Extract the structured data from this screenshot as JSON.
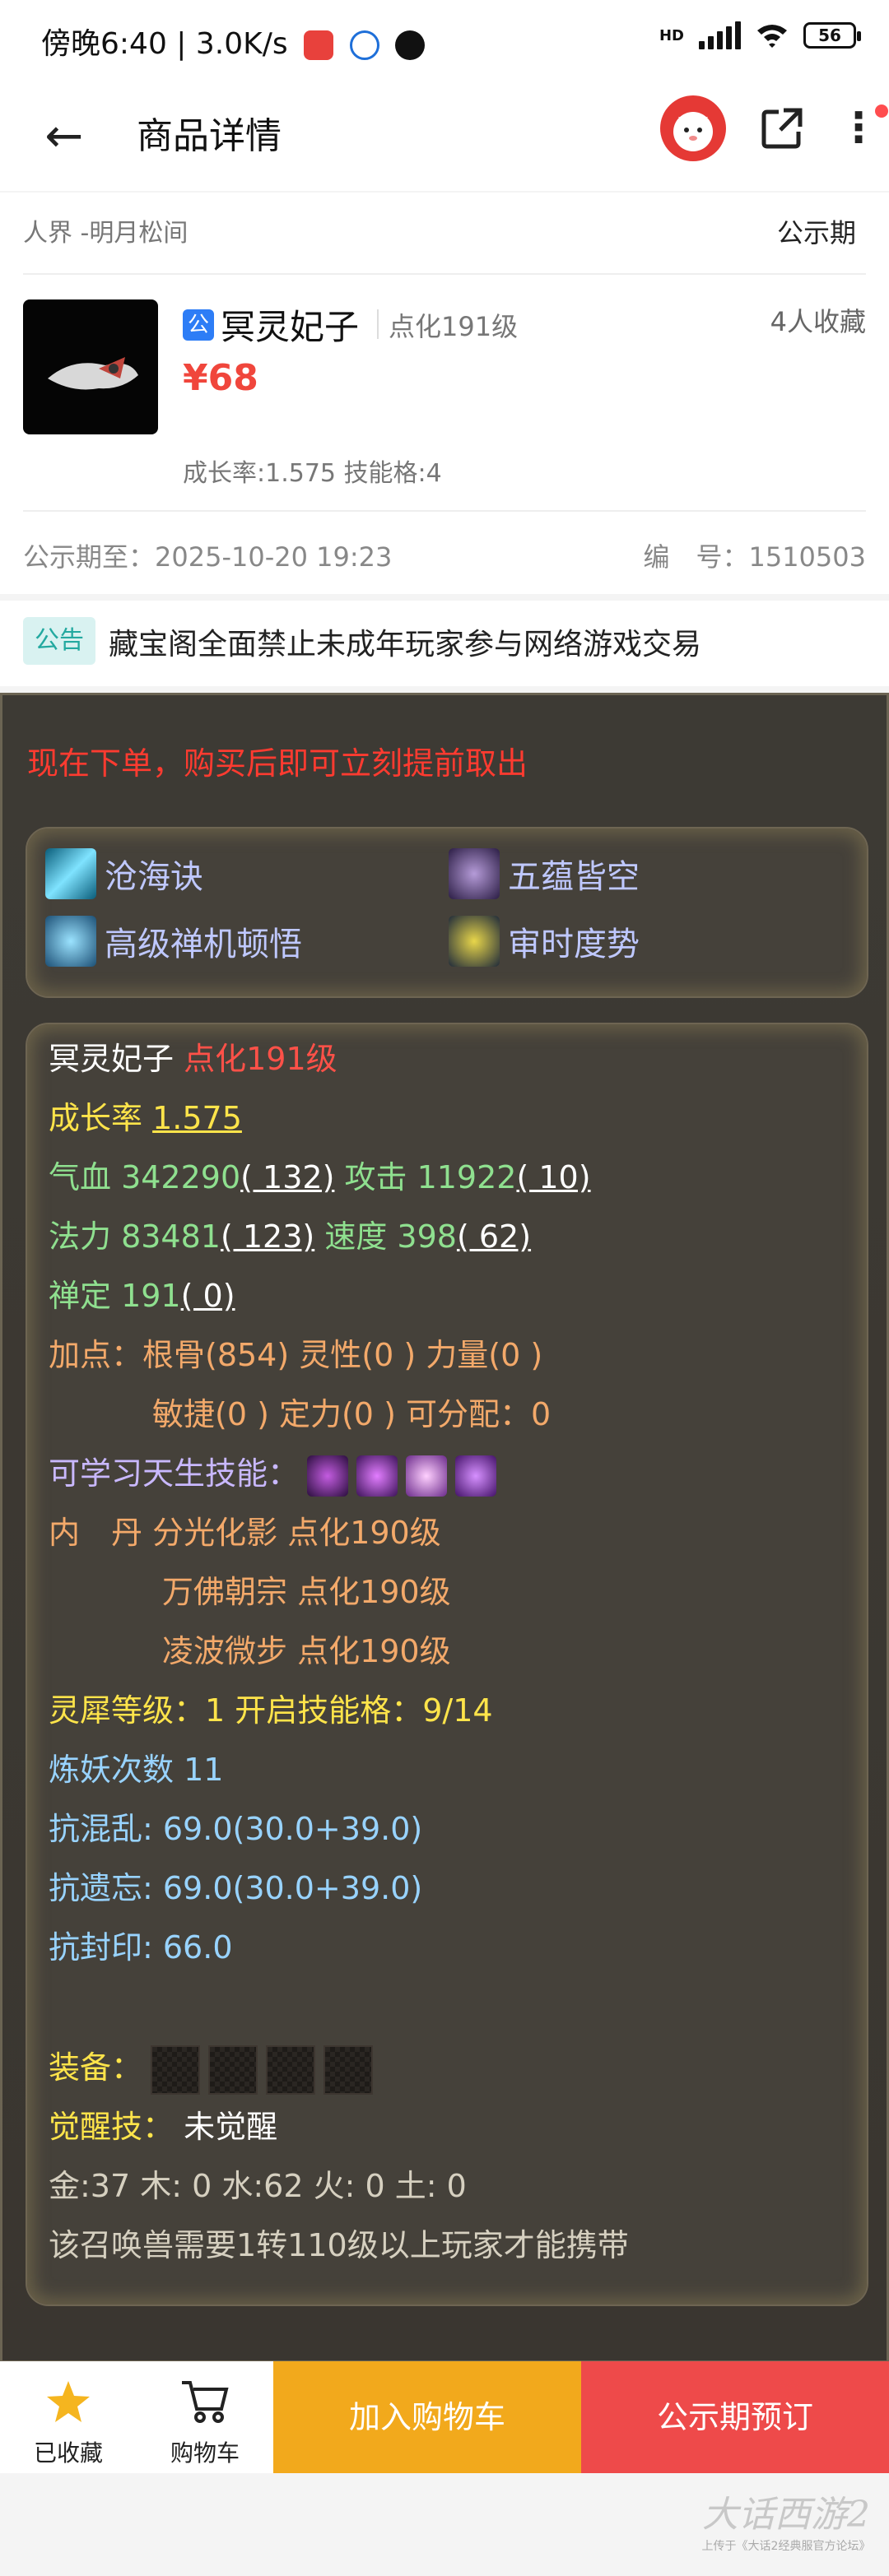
{
  "status_bar": {
    "time": "傍晚6:40",
    "speed": "3.0K/s",
    "battery": "56"
  },
  "header": {
    "title": "商品详情"
  },
  "listing": {
    "server": "人界 -明月松间",
    "period_label": "公示期",
    "gong_tag": "公",
    "pet_name": "冥灵妃子",
    "pet_level": "点化191级",
    "favorites": "4人收藏",
    "price": "¥68",
    "growth_skill": "成长率:1.575 技能格:4",
    "public_until": "公示期至：2025-10-20 19:23",
    "serial": "编　号：1510503"
  },
  "notice": {
    "tag": "公告",
    "text": "藏宝阁全面禁止未成年玩家参与网络游戏交易"
  },
  "detail": {
    "promo": "现在下单，购买后即可立刻提前取出",
    "skills": [
      "沧海诀",
      "五蕴皆空",
      "高级禅机顿悟",
      "审时度势"
    ],
    "name": "冥灵妃子",
    "level": "点化191级",
    "growth_label": "成长率",
    "growth_value": "1.575",
    "hp_label": "气血 342290",
    "hp_add": "( 132)",
    "atk_label": "攻击 11922",
    "atk_add": "( 10)",
    "mp_label": "法力 83481",
    "mp_add": "( 123)",
    "spd_label": "速度 398",
    "spd_add": "( 62)",
    "zen_label": "禅定 191",
    "zen_add": "( 0)",
    "points1": "加点：根骨(854) 灵性(0 ) 力量(0 )",
    "points2": "敏捷(0 ) 定力(0 ) 可分配：0",
    "learnable": "可学习天生技能：",
    "neidan_label": "内　丹",
    "neidan1": "分光化影 点化190级",
    "neidan2": "万佛朝宗 点化190级",
    "neidan3": "凌波微步 点化190级",
    "lingxi": "灵犀等级：1 开启技能格：9/14",
    "lianyao": "炼妖次数 11",
    "res1": "抗混乱: 69.0(30.0+39.0)",
    "res2": "抗遗忘: 69.0(30.0+39.0)",
    "res3": "抗封印: 66.0",
    "equip": "装备：",
    "awaken_label": "觉醒技：",
    "awaken_value": "未觉醒",
    "elements": "金:37 木: 0 水:62 火: 0 土: 0",
    "requirement": "该召唤兽需要1转110级以上玩家才能携带"
  },
  "bottom_bar": {
    "fav_label": "已收藏",
    "cart_label": "购物车",
    "add_cart": "加入购物车",
    "reserve": "公示期预订"
  },
  "watermark": {
    "line1": "大话西游2",
    "line2": "上传于《大话2经典服官方论坛》"
  },
  "colors": {
    "price_red": "#f0463c",
    "add_cart_bg": "#f2a91c",
    "reserve_bg": "#ee4a4a",
    "panel_bg": "#3d3a34"
  }
}
